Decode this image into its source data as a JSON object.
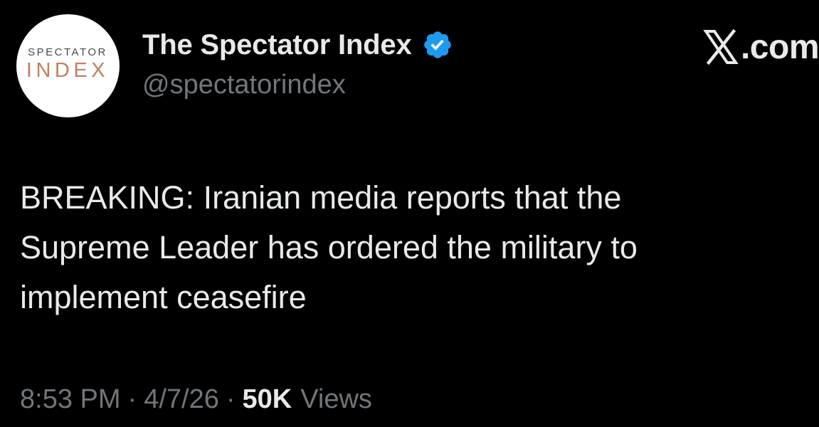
{
  "account": {
    "avatar_text_top": "SPECTATOR",
    "avatar_text_bottom": "INDEX",
    "avatar_text_color": "#c0815e",
    "display_name": "The Spectator Index",
    "handle": "@spectatorindex",
    "verified_icon": "verified-badge-icon",
    "verified_color": "#1d9bf0"
  },
  "brand": {
    "icon": "x-logo-icon",
    "text": ".com"
  },
  "tweet": {
    "lines": [
      "BREAKING: Iranian media reports that the",
      "Supreme Leader has ordered the military to",
      "implement ceasefire"
    ]
  },
  "meta": {
    "time": "8:53 PM",
    "separator": "·",
    "date": "4/7/26",
    "views_count": "50K",
    "views_label": "Views"
  },
  "colors": {
    "background": "#000000",
    "primary_text": "#e7e9ea",
    "secondary_text": "#71767b"
  }
}
